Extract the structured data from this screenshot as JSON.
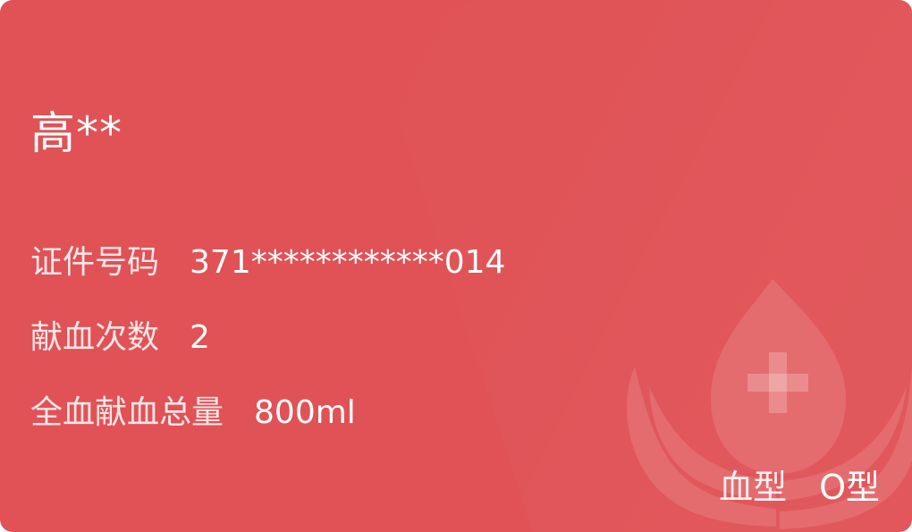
{
  "card": {
    "name": "高**",
    "id_label": "证件号码",
    "id_value": "371************014",
    "count_label": "献血次数",
    "count_value": "2",
    "total_label": "全血献血总量",
    "total_value": "800ml",
    "blood_type_label": "血型",
    "blood_type_value": "O型"
  },
  "icons": {
    "emblem": "blood-drop-cross-hands-icon"
  },
  "colors": {
    "card_background": "#e05256",
    "text": "#ffffff"
  }
}
